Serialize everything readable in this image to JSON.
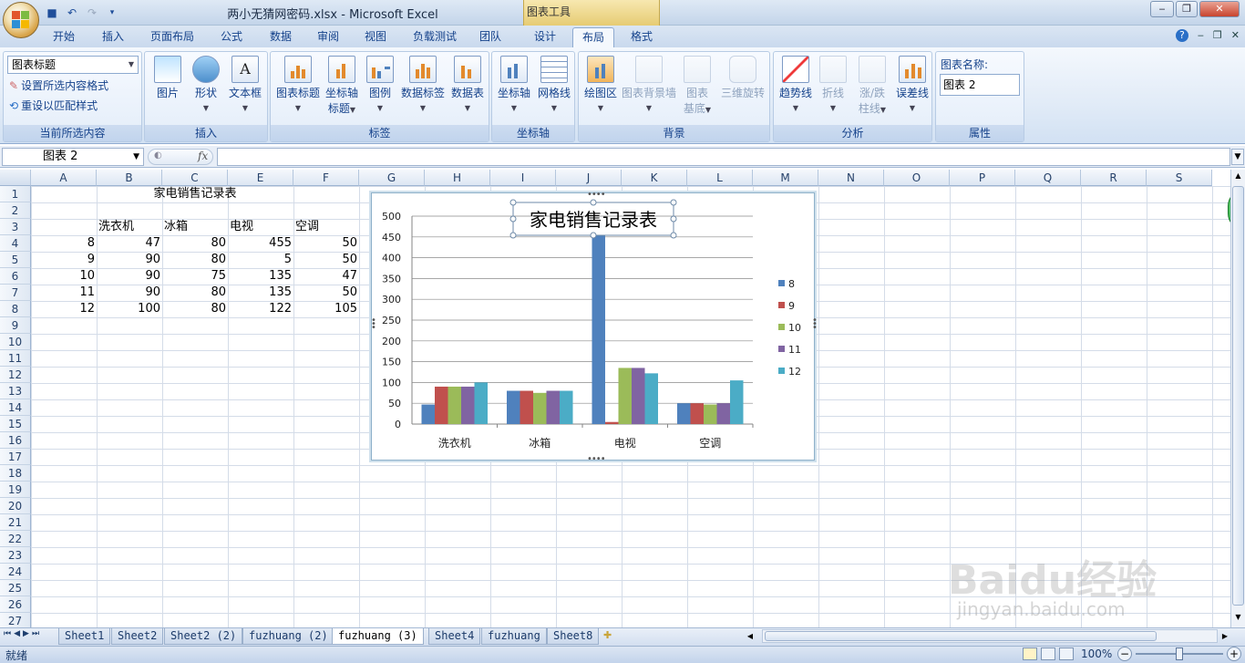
{
  "titlebar": {
    "doc_title": "两小无猜网密码.xlsx - Microsoft Excel",
    "contextual_group": "图表工具"
  },
  "tabs": [
    "开始",
    "插入",
    "页面布局",
    "公式",
    "数据",
    "审阅",
    "视图",
    "负载测试",
    "团队",
    "设计",
    "布局",
    "格式"
  ],
  "active_tab": "布局",
  "ribbon": {
    "current_selection": {
      "dropdown_value": "图表标题",
      "format_selection": "设置所选内容格式",
      "reset_style": "重设以匹配样式",
      "label": "当前所选内容"
    },
    "insert": {
      "picture": "图片",
      "shapes": "形状",
      "textbox": "文本框",
      "label": "插入"
    },
    "labels": {
      "chart_title": "图表标题",
      "axis_titles_1": "坐标轴",
      "axis_titles_2": "标题",
      "legend": "图例",
      "data_labels": "数据标签",
      "data_table": "数据表",
      "label": "标签"
    },
    "axes": {
      "axes": "坐标轴",
      "gridlines": "网格线",
      "label": "坐标轴"
    },
    "background": {
      "plot_area": "绘图区",
      "chart_wall": "图表背景墙",
      "chart_floor_1": "图表",
      "chart_floor_2": "基底",
      "rotation": "三维旋转",
      "label": "背景"
    },
    "analysis": {
      "trendline": "趋势线",
      "lines": "折线",
      "updown_1": "涨/跌",
      "updown_2": "柱线",
      "error_bars": "误差线",
      "label": "分析"
    },
    "properties": {
      "name_label": "图表名称:",
      "name_value": "图表 2",
      "label": "属性"
    }
  },
  "formula_bar": {
    "name_box": "图表 2",
    "fx": "fx"
  },
  "columns": [
    "A",
    "B",
    "C",
    "E",
    "F",
    "G",
    "H",
    "I",
    "J",
    "K",
    "L",
    "M",
    "N",
    "O",
    "P",
    "Q",
    "R",
    "S"
  ],
  "rows": [
    "1",
    "2",
    "3",
    "4",
    "5",
    "6",
    "7",
    "8",
    "9",
    "10",
    "11",
    "12",
    "13",
    "14",
    "15",
    "16",
    "17",
    "18",
    "19",
    "20",
    "21",
    "22",
    "23",
    "24",
    "25",
    "26",
    "27"
  ],
  "sheet": {
    "title": "家电销售记录表",
    "headers": [
      "洗衣机",
      "冰箱",
      "电视",
      "空调"
    ],
    "data": [
      [
        "8",
        "47",
        "80",
        "455",
        "50"
      ],
      [
        "9",
        "90",
        "80",
        "5",
        "50"
      ],
      [
        "10",
        "90",
        "75",
        "135",
        "47"
      ],
      [
        "11",
        "90",
        "80",
        "135",
        "50"
      ],
      [
        "12",
        "100",
        "80",
        "122",
        "105"
      ]
    ]
  },
  "chart_data": {
    "type": "bar",
    "title": "家电销售记录表",
    "categories": [
      "洗衣机",
      "冰箱",
      "电视",
      "空调"
    ],
    "series": [
      {
        "name": "8",
        "values": [
          47,
          80,
          455,
          50
        ],
        "color": "#4f81bd"
      },
      {
        "name": "9",
        "values": [
          90,
          80,
          5,
          50
        ],
        "color": "#c0504d"
      },
      {
        "name": "10",
        "values": [
          90,
          75,
          135,
          47
        ],
        "color": "#9bbb59"
      },
      {
        "name": "11",
        "values": [
          90,
          80,
          135,
          50
        ],
        "color": "#8064a2"
      },
      {
        "name": "12",
        "values": [
          100,
          80,
          122,
          105
        ],
        "color": "#4bacc6"
      }
    ],
    "yticks": [
      "0",
      "50",
      "100",
      "150",
      "200",
      "250",
      "300",
      "350",
      "400",
      "450",
      "500"
    ],
    "ylim": [
      0,
      500
    ],
    "grid": true,
    "legend": "right"
  },
  "sheet_tabs": [
    "Sheet1",
    "Sheet2",
    "Sheet2 (2)",
    "fuzhuang (2)",
    "fuzhuang (3)",
    "Sheet4",
    "fuzhuang",
    "Sheet8"
  ],
  "active_sheet": "fuzhuang (3)",
  "status": {
    "ready": "就绪",
    "zoom": "100%"
  },
  "watermark": {
    "brand": "Baidu经验",
    "url": "jingyan.baidu.com"
  }
}
